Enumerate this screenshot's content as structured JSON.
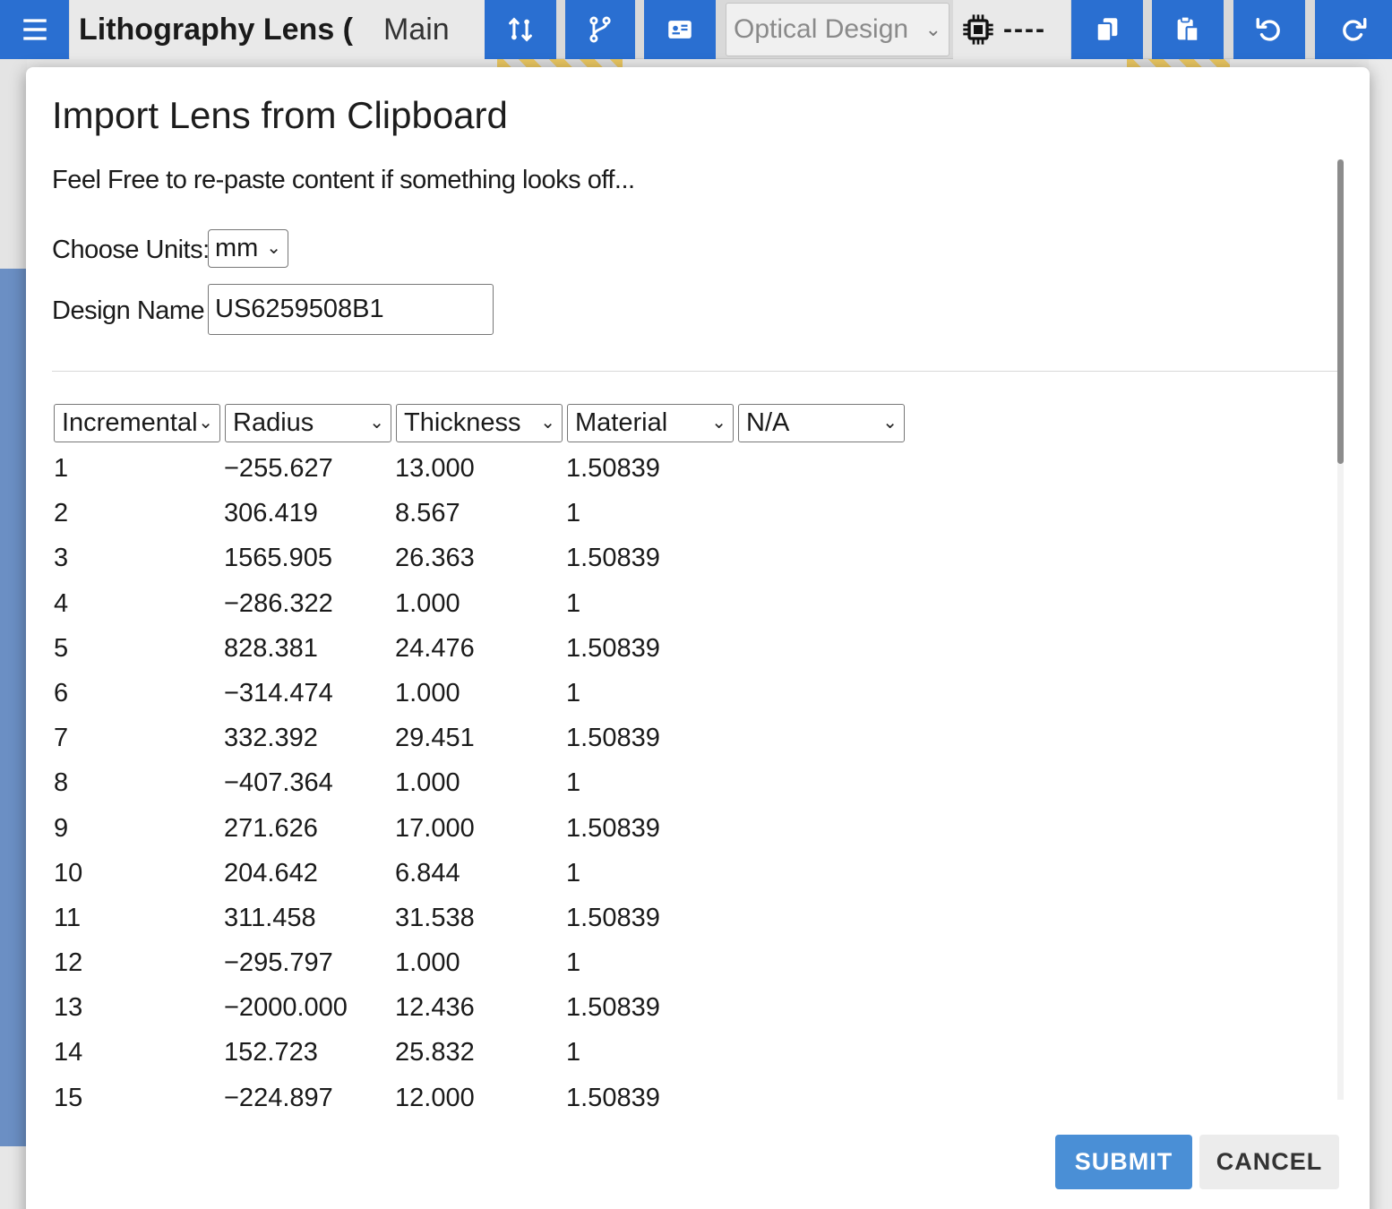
{
  "toolbar": {
    "app_title": "Lithography Lens (",
    "branch": "Main",
    "mode": "Optical Design",
    "chip_status": "----",
    "icons": [
      "menu-icon",
      "swap-icon",
      "branch-icon",
      "id-card-icon",
      "chip-icon",
      "copy-icon",
      "paste-icon",
      "undo-icon",
      "redo-icon"
    ]
  },
  "dialog": {
    "title": "Import Lens from Clipboard",
    "hint": "Feel Free to re-paste content if something looks off...",
    "units_label": "Choose Units:",
    "units_value": "mm",
    "design_name_label": "Design Name",
    "design_name_value": "US6259508B1",
    "columns": [
      "Incremental",
      "Radius",
      "Thickness",
      "Material",
      "N/A"
    ],
    "rows": [
      [
        "1",
        "−255.627",
        "13.000",
        "1.50839"
      ],
      [
        "2",
        "306.419",
        "8.567",
        "1"
      ],
      [
        "3",
        "1565.905",
        "26.363",
        "1.50839"
      ],
      [
        "4",
        "−286.322",
        "1.000",
        "1"
      ],
      [
        "5",
        "828.381",
        "24.476",
        "1.50839"
      ],
      [
        "6",
        "−314.474",
        "1.000",
        "1"
      ],
      [
        "7",
        "332.392",
        "29.451",
        "1.50839"
      ],
      [
        "8",
        "−407.364",
        "1.000",
        "1"
      ],
      [
        "9",
        "271.626",
        "17.000",
        "1.50839"
      ],
      [
        "10",
        "204.642",
        "6.844",
        "1"
      ],
      [
        "11",
        "311.458",
        "31.538",
        "1.50839"
      ],
      [
        "12",
        "−295.797",
        "1.000",
        "1"
      ],
      [
        "13",
        "−2000.000",
        "12.436",
        "1.50839"
      ],
      [
        "14",
        "152.723",
        "25.832",
        "1"
      ],
      [
        "15",
        "−224.897",
        "12.000",
        "1.50839"
      ]
    ],
    "submit_label": "SUBMIT",
    "cancel_label": "CANCEL"
  },
  "colors": {
    "toolbar_blue": "#2a6fd1",
    "submit_blue": "#4a8fd6"
  }
}
